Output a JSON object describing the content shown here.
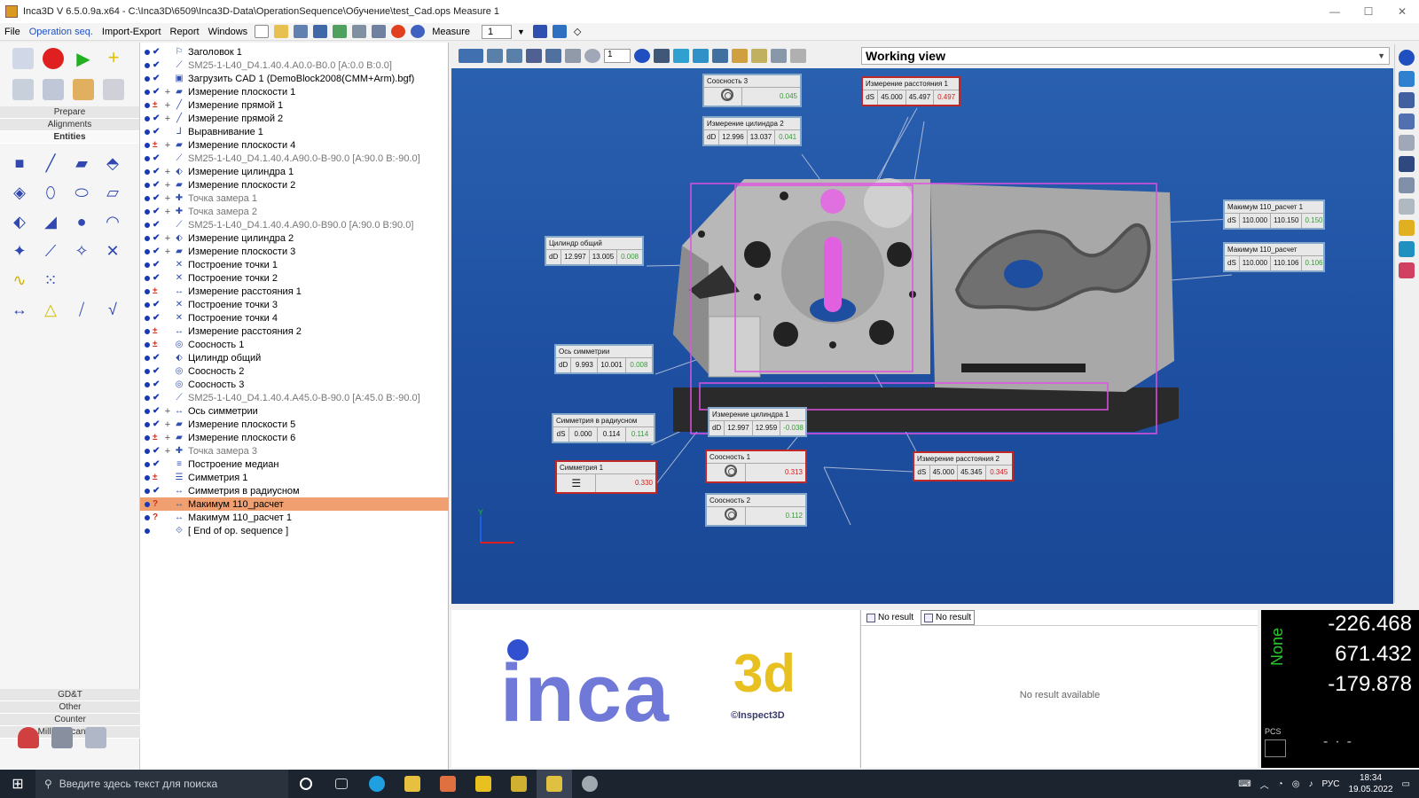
{
  "window": {
    "title": "Inca3D V 6.5.0.9a.x64 - C:\\Inca3D\\6509\\Inca3D-Data\\OperationSequence\\Обучение\\test_Cad.ops   Measure 1"
  },
  "menu": {
    "items": [
      "File",
      "Operation seq.",
      "Import-Export",
      "Report",
      "Windows"
    ],
    "measure_label": "Measure",
    "measure_value": "1"
  },
  "palette": {
    "categories_top": [
      "Prepare",
      "Alignments",
      "Entities"
    ],
    "categories_bottom": [
      "GD&T",
      "Other",
      "Counter",
      "Milling/Scanning"
    ]
  },
  "tree": {
    "rows": [
      {
        "label": "Заголовок 1",
        "status": "ok",
        "exp": "",
        "icon": "header-icon",
        "gray": false,
        "hl": false
      },
      {
        "label": "SM25-1-L40_D4.1.40.4.A0.0-B0.0 [A:0.0 B:0.0]",
        "status": "ok",
        "exp": "",
        "icon": "probe-icon",
        "gray": true,
        "hl": false
      },
      {
        "label": "Загрузить CAD 1  (DemoBlock2008(CMM+Arm).bgf)",
        "status": "ok",
        "exp": "",
        "icon": "cad-icon",
        "gray": false,
        "hl": false
      },
      {
        "label": "Измерение плоскости 1",
        "status": "ok",
        "exp": "+",
        "icon": "plane-icon",
        "gray": false,
        "hl": false
      },
      {
        "label": "Измерение прямой 1",
        "status": "warn",
        "exp": "+",
        "icon": "line-icon",
        "gray": false,
        "hl": false
      },
      {
        "label": "Измерение прямой 2",
        "status": "ok",
        "exp": "+",
        "icon": "line-icon",
        "gray": false,
        "hl": false
      },
      {
        "label": "Выравнивание 1",
        "status": "ok",
        "exp": "",
        "icon": "align-icon",
        "gray": false,
        "hl": false
      },
      {
        "label": "Измерение плоскости 4",
        "status": "warn",
        "exp": "+",
        "icon": "plane-icon",
        "gray": false,
        "hl": false
      },
      {
        "label": "SM25-1-L40_D4.1.40.4.A90.0-B-90.0 [A:90.0 B:-90.0]",
        "status": "ok",
        "exp": "",
        "icon": "probe-icon",
        "gray": true,
        "hl": false
      },
      {
        "label": "Измерение цилиндра 1",
        "status": "ok",
        "exp": "+",
        "icon": "cylinder-icon",
        "gray": false,
        "hl": false
      },
      {
        "label": "Измерение плоскости 2",
        "status": "ok",
        "exp": "+",
        "icon": "plane-icon",
        "gray": false,
        "hl": false
      },
      {
        "label": "Точка замера 1",
        "status": "ok",
        "exp": "+",
        "icon": "point-icon",
        "gray": true,
        "hl": false
      },
      {
        "label": "Точка замера 2",
        "status": "ok",
        "exp": "+",
        "icon": "point-icon",
        "gray": true,
        "hl": false
      },
      {
        "label": "SM25-1-L40_D4.1.40.4.A90.0-B90.0 [A:90.0 B:90.0]",
        "status": "ok",
        "exp": "",
        "icon": "probe-icon",
        "gray": true,
        "hl": false
      },
      {
        "label": "Измерение цилиндра 2",
        "status": "ok",
        "exp": "+",
        "icon": "cylinder-icon",
        "gray": false,
        "hl": false
      },
      {
        "label": "Измерение плоскости 3",
        "status": "ok",
        "exp": "+",
        "icon": "plane-icon",
        "gray": false,
        "hl": false
      },
      {
        "label": "Построение точки 1",
        "status": "ok",
        "exp": "",
        "icon": "construct-point-icon",
        "gray": false,
        "hl": false
      },
      {
        "label": "Построение точки 2",
        "status": "ok",
        "exp": "",
        "icon": "construct-point-icon",
        "gray": false,
        "hl": false
      },
      {
        "label": "Измерение расстояния 1",
        "status": "warn",
        "exp": "",
        "icon": "distance-icon",
        "gray": false,
        "hl": false
      },
      {
        "label": "Построение точки 3",
        "status": "ok",
        "exp": "",
        "icon": "construct-point-icon",
        "gray": false,
        "hl": false
      },
      {
        "label": "Построение точки 4",
        "status": "ok",
        "exp": "",
        "icon": "construct-point-icon",
        "gray": false,
        "hl": false
      },
      {
        "label": "Измерение расстояния 2",
        "status": "warn",
        "exp": "",
        "icon": "distance-icon",
        "gray": false,
        "hl": false
      },
      {
        "label": "Соосность 1",
        "status": "warn",
        "exp": "",
        "icon": "coaxiality-icon",
        "gray": false,
        "hl": false
      },
      {
        "label": "Цилиндр общий",
        "status": "ok",
        "exp": "",
        "icon": "cylinder-icon",
        "gray": false,
        "hl": false
      },
      {
        "label": "Соосность 2",
        "status": "ok",
        "exp": "",
        "icon": "coaxiality-icon",
        "gray": false,
        "hl": false
      },
      {
        "label": "Соосность 3",
        "status": "ok",
        "exp": "",
        "icon": "coaxiality-icon",
        "gray": false,
        "hl": false
      },
      {
        "label": "SM25-1-L40_D4.1.40.4.A45.0-B-90.0 [A:45.0 B:-90.0]",
        "status": "ok",
        "exp": "",
        "icon": "probe-icon",
        "gray": true,
        "hl": false
      },
      {
        "label": "Ось симметрии",
        "status": "ok",
        "exp": "+",
        "icon": "distance-icon",
        "gray": false,
        "hl": false
      },
      {
        "label": "Измерение плоскости 5",
        "status": "ok",
        "exp": "+",
        "icon": "plane-icon",
        "gray": false,
        "hl": false
      },
      {
        "label": "Измерение плоскости 6",
        "status": "warn",
        "exp": "+",
        "icon": "plane-icon",
        "gray": false,
        "hl": false
      },
      {
        "label": "Точка замера 3",
        "status": "ok",
        "exp": "+",
        "icon": "point-icon",
        "gray": true,
        "hl": false
      },
      {
        "label": "Построение медиан",
        "status": "ok",
        "exp": "",
        "icon": "median-icon",
        "gray": false,
        "hl": false
      },
      {
        "label": "Симметрия 1",
        "status": "warn",
        "exp": "",
        "icon": "symmetry-icon",
        "gray": false,
        "hl": false
      },
      {
        "label": "Симметрия в радиусном",
        "status": "ok",
        "exp": "",
        "icon": "distance-icon",
        "gray": false,
        "hl": false
      },
      {
        "label": "Макимум 110_расчет",
        "status": "q",
        "exp": "",
        "icon": "distance-icon",
        "gray": false,
        "hl": true
      },
      {
        "label": "Макимум 110_расчет 1",
        "status": "q",
        "exp": "",
        "icon": "distance-icon",
        "gray": false,
        "hl": false
      },
      {
        "label": "[ End of op. sequence ]",
        "status": "none",
        "exp": "",
        "icon": "end-icon",
        "gray": false,
        "hl": false
      }
    ]
  },
  "viewport": {
    "view_name": "Working view",
    "zoom_field": "1"
  },
  "labels": [
    {
      "title": "Соосность 3",
      "kind": "circ",
      "vals": [
        "0.045"
      ],
      "classes": [
        "grn"
      ],
      "ok": true
    },
    {
      "title": "Измерение расстояния 1",
      "kind": "dS",
      "vals": [
        "45.000",
        "45.497",
        "0.497"
      ],
      "classes": [
        "",
        "",
        "red"
      ],
      "ok": false
    },
    {
      "title": "Измерение цилиндра 2",
      "kind": "dD",
      "vals": [
        "12.996",
        "13.037",
        "0.041"
      ],
      "classes": [
        "",
        "",
        "grn"
      ],
      "ok": true
    },
    {
      "title": "Цилиндр общий",
      "kind": "dD",
      "vals": [
        "12.997",
        "13.005",
        "0.008"
      ],
      "classes": [
        "",
        "",
        "grn"
      ],
      "ok": true
    },
    {
      "title": "Макимум 110_расчет 1",
      "kind": "dS",
      "vals": [
        "110.000",
        "110.150",
        "0.150"
      ],
      "classes": [
        "",
        "",
        "grn"
      ],
      "ok": true
    },
    {
      "title": "Макимум 110_расчет",
      "kind": "dS",
      "vals": [
        "110.000",
        "110.106",
        "0.106"
      ],
      "classes": [
        "",
        "",
        "grn"
      ],
      "ok": true
    },
    {
      "title": "Ось симметрии",
      "kind": "dD",
      "vals": [
        "9.993",
        "10.001",
        "0.008"
      ],
      "classes": [
        "",
        "",
        "grn"
      ],
      "ok": true
    },
    {
      "title": "Симметрия в радиусном",
      "kind": "dS",
      "vals": [
        "0.000",
        "0.114",
        "0.114"
      ],
      "classes": [
        "",
        "",
        "grn"
      ],
      "ok": true
    },
    {
      "title": "Измерение цилиндра 1",
      "kind": "dD",
      "vals": [
        "12.997",
        "12.959",
        "-0.038"
      ],
      "classes": [
        "",
        "",
        "grn"
      ],
      "ok": true
    },
    {
      "title": "Симметрия 1",
      "kind": "sym",
      "vals": [
        "0.330"
      ],
      "classes": [
        "red"
      ],
      "ok": false
    },
    {
      "title": "Соосность 1",
      "kind": "circ",
      "vals": [
        "0.313"
      ],
      "classes": [
        "red"
      ],
      "ok": false
    },
    {
      "title": "Соосность 2",
      "kind": "circ",
      "vals": [
        "0.112"
      ],
      "classes": [
        "grn"
      ],
      "ok": true
    },
    {
      "title": "Измерение расстояния 2",
      "kind": "dS",
      "vals": [
        "45.000",
        "45.345",
        "0.345"
      ],
      "classes": [
        "",
        "",
        "red"
      ],
      "ok": false
    }
  ],
  "logo": {
    "text": "inca",
    "suffix": "3d",
    "copyright": "©Inspect3D"
  },
  "results": {
    "tab1": "No result",
    "tab2": "No result",
    "message": "No result available"
  },
  "coords": {
    "mode": "None",
    "x": "-226.468",
    "y": "671.432",
    "z": "-179.878",
    "pcs": "PCS"
  },
  "taskbar": {
    "search_placeholder": "Введите здесь текст для поиска",
    "lang": "РУС",
    "time": "18:34",
    "date": "19.05.2022"
  },
  "colors": {
    "accent_blue": "#1838b8",
    "warn_red": "#c83020",
    "highlight": "#f0a070",
    "viewport_bg": "#1d4ea0",
    "ok_green": "#3a9a3a"
  }
}
